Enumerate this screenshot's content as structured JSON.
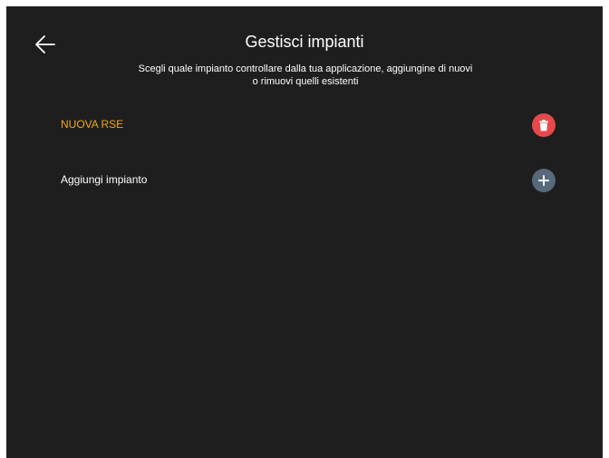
{
  "header": {
    "back_icon": "arrow-left-icon",
    "title": "Gestisci impianti",
    "subtitle_line1": "Scegli quale impianto controllare dalla tua applicazione, aggiungine di nuovi",
    "subtitle_line2": "o rimuovi quelli esistenti"
  },
  "plants": [
    {
      "label": "NUOVA RSE",
      "action_icon": "trash-icon",
      "label_color": "#f0a81e",
      "icon_bg": "#e8474b"
    }
  ],
  "add_plant": {
    "label": "Aggiungi impianto",
    "action_icon": "plus-icon",
    "icon_bg": "#57697a"
  },
  "colors": {
    "background": "#1e1e1e",
    "text": "#ffffff"
  }
}
